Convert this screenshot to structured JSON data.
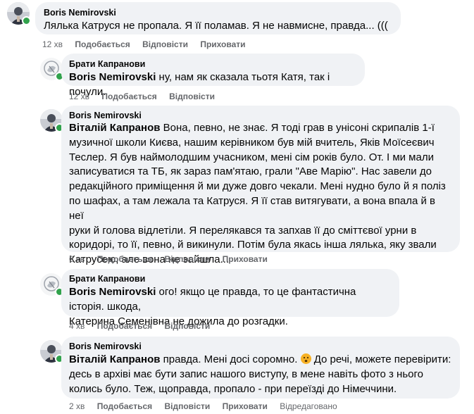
{
  "thread": [
    {
      "author": "Boris Nemirovski",
      "mention": "",
      "text": "Лялька Катруся не пропала. Я її поламав. Я не навмисне, правда... (((",
      "time": "12 хв",
      "like": "Подобається",
      "reply": "Відповісти",
      "hide": "Приховати"
    },
    {
      "author": "Брати Капранови",
      "mention": "Boris Nemirovski",
      "text": " ну, нам як сказала тьотя Катя, так і почули.",
      "time": "12 хв",
      "like": "Подобається",
      "reply": "Відповісти"
    },
    {
      "author": "Boris Nemirovski",
      "mention": "Віталій Капранов",
      "lines": [
        " Вона, певно, не знає. Я тоді грав в унісоні скрипалів 1-ї",
        "музичної школи Києва, нашим керівником був мій вчитель, Яків Моїсеєвич",
        "Теслер. Я був наймолодшим учасником, мені сім років було. От. І ми мали",
        "записуватися та ТБ, як зараз пам'ятаю, грали \"Аве Марію\". Нас завели до",
        "редакційного приміщення й ми дуже довго чекали. Мені нудно було й я поліз",
        "по шафах, а там лежала та Катруся. Я її став витягувати, а вона впала й в неї",
        "руки й голова відлетіли. Я перелякався та запхав її до сміттєвої урни в",
        "коридорі, то її, певно, й викинули. Потім була якась інша лялька, яку звали",
        "Катрусею, але вона не зайшла..."
      ],
      "time": "6 хв",
      "like": "Подобається",
      "reply": "Відповісти",
      "hide": "Приховати"
    },
    {
      "author": "Брати Капранови",
      "mention": "Boris Nemirovski",
      "lines": [
        " ого! якщо це правда, то це фантастична історія. шкода,",
        "Катерина Семенівна не дожила до розгадки."
      ],
      "time": "4 хв",
      "like": "Подобається",
      "reply": "Відповісти"
    },
    {
      "author": "Boris Nemirovski",
      "mention": "Віталій Капранов",
      "lines": [
        " правда. Мені досі соромно.",
        "десь в архіві має бути запис нашого виступу, в мене навіть фото з нього",
        "колись було. Теж, щоправда, пропало - при переїзді до Німеччини."
      ],
      "line1_after_emoji": " До речі, можете перевірити:",
      "time": "2 хв",
      "like": "Подобається",
      "reply": "Відповісти",
      "hide": "Приховати",
      "edited": "Відредаговано"
    }
  ],
  "colors": {
    "bubble": "#f0f2f5",
    "meta": "#65676b",
    "online": "#31a24c",
    "emoji": "#f7b125"
  },
  "icons": [
    "avatar-boris-icon",
    "avatar-kapranovy-icon",
    "sad-face-emoji-icon"
  ]
}
